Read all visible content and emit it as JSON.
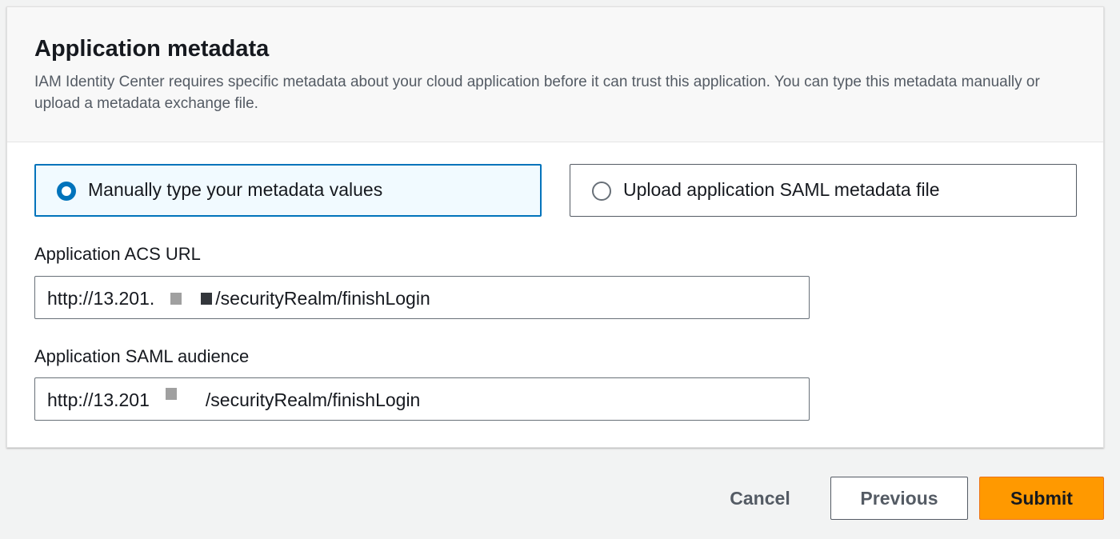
{
  "panel": {
    "title": "Application metadata",
    "description": "IAM Identity Center requires specific metadata about your cloud application before it can trust this application. You can type this metadata manually or upload a metadata exchange file."
  },
  "metadata_options": {
    "selected": "manual",
    "manual_label": "Manually type your metadata values",
    "upload_label": "Upload application SAML metadata file"
  },
  "acs_url": {
    "label": "Application ACS URL",
    "value_prefix": "http://13.201.",
    "value_suffix": "/securityRealm/finishLogin"
  },
  "saml_audience": {
    "label": "Application SAML audience",
    "value_prefix": "http://13.201",
    "value_suffix": "/securityRealm/finishLogin"
  },
  "actions": {
    "cancel": "Cancel",
    "previous": "Previous",
    "submit": "Submit"
  },
  "colors": {
    "accent": "#0073bb",
    "primary_button": "#ff9900"
  }
}
